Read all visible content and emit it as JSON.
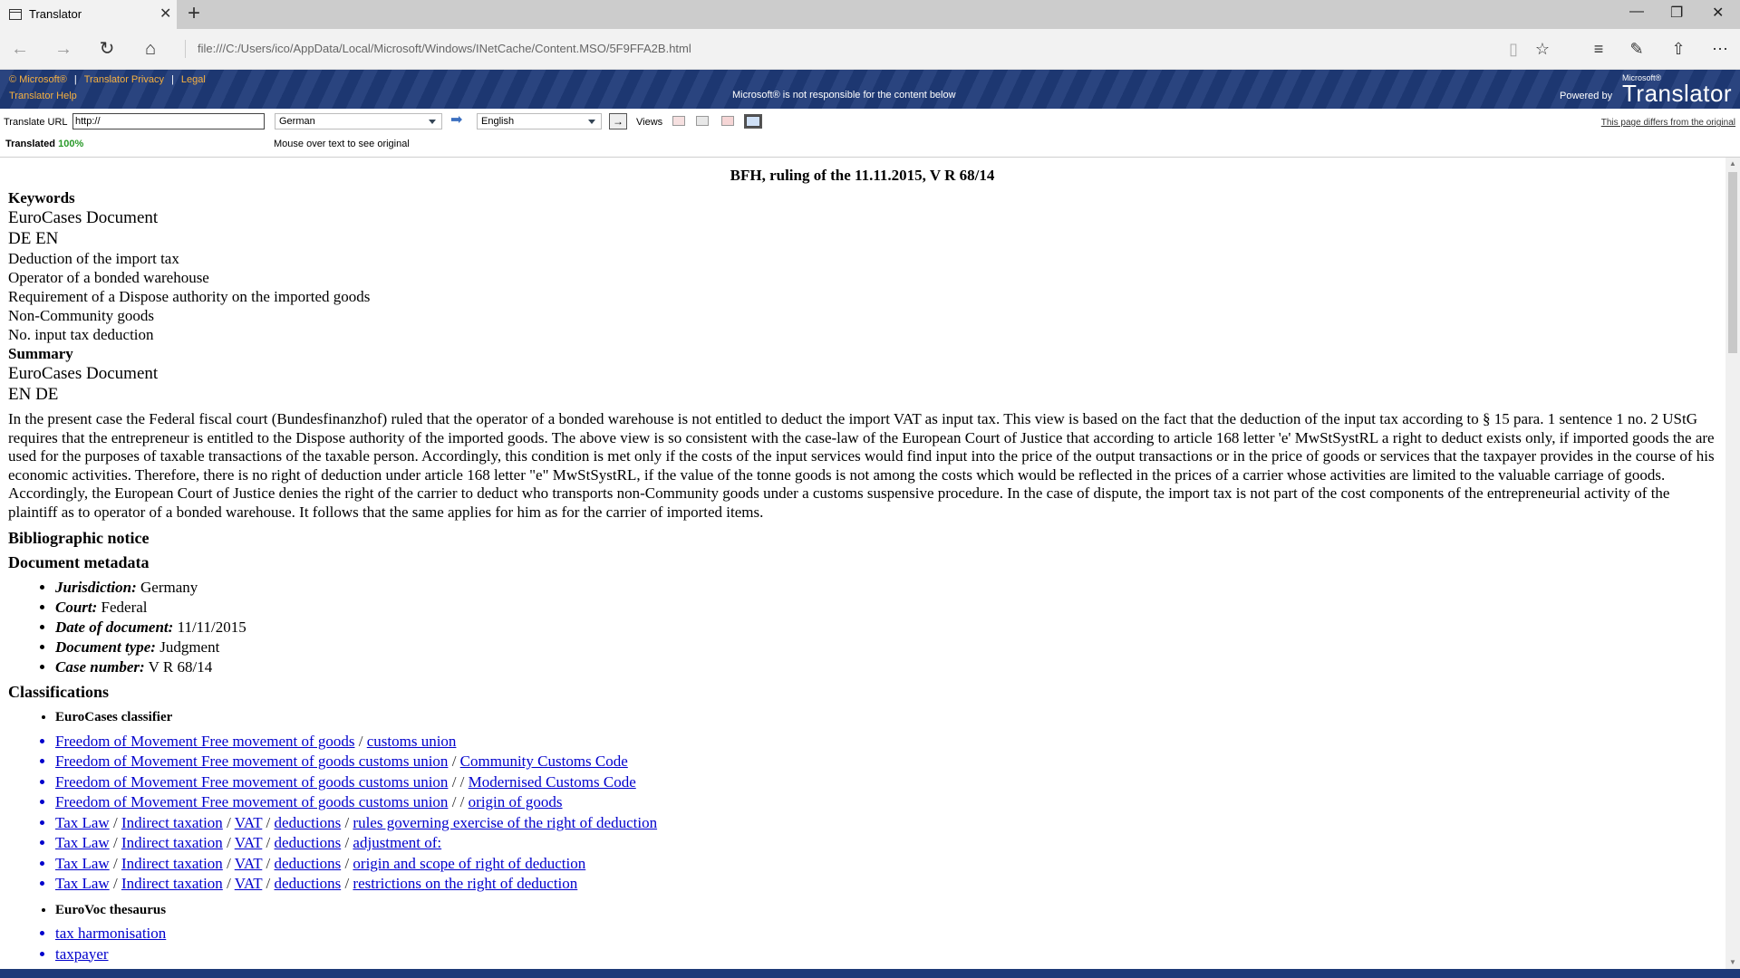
{
  "browser": {
    "tab_title": "Translator",
    "tab_close": "✕",
    "new_tab": "+",
    "url": "file:///C:/Users/ico/AppData/Local/Microsoft/Windows/INetCache/Content.MSO/5F9FFA2B.html",
    "window_controls": {
      "minimize": "—",
      "restore": "❐",
      "close": "✕"
    }
  },
  "banner": {
    "microsoft": "© Microsoft®",
    "privacy": "Translator Privacy",
    "legal": "Legal",
    "help": "Translator Help",
    "notice": "Microsoft® is not responsible for the content below",
    "powered_by": "Powered by",
    "ms_small": "Microsoft®",
    "brand": "Translator"
  },
  "toolbar": {
    "translate_url_label": "Translate URL",
    "url_value": "http://",
    "from_lang": "German",
    "to_lang": "English",
    "views_label": "Views",
    "differs": "This page differs from the original",
    "translated_label": "Translated",
    "translated_pct": "100%",
    "mouse_hint": "Mouse over text to see original"
  },
  "document": {
    "title": "BFH, ruling of the 11.11.2015, V R 68/14",
    "keywords_heading": "Keywords",
    "eurocases_doc_1": "EuroCases Document",
    "langs_1": "DE EN",
    "keywords": [
      "Deduction of the import tax",
      "Operator of a bonded warehouse",
      "Requirement of a Dispose authority on the imported goods",
      "Non-Community goods",
      "No. input tax deduction"
    ],
    "summary_heading": "Summary",
    "eurocases_doc_2": "EuroCases Document",
    "langs_2": "EN DE",
    "summary_text": "In the present case the Federal fiscal court (Bundesfinanzhof) ruled that the operator of a bonded warehouse is not entitled to deduct the import VAT as input tax. This view is based on the fact that the deduction of the input tax according to § 15 para. 1 sentence 1 no. 2 UStG requires that the entrepreneur is entitled to the Dispose authority of the imported goods. The above view is so consistent with the case-law of the European Court of Justice that according to article 168 letter 'e' MwStSystRL a right to deduct exists only, if imported goods the are used for the purposes of taxable transactions of the taxable person. Accordingly, this condition is met only if the costs of the input services would find input into the price of the output transactions or in the price of goods or services that the taxpayer provides in the course of his economic activities. Therefore, there is no right of deduction under article 168 letter \"e\" MwStSystRL, if the value of the tonne goods is not among the costs which would be reflected in the prices of a carrier whose activities are limited to the valuable carriage of goods. Accordingly, the European Court of Justice denies the right of the carrier to deduct who transports non-Community goods under a customs suspensive procedure. In the case of dispute, the import tax is not part of the cost components of the entrepreneurial activity of the plaintiff as to operator of a bonded warehouse. It follows that the same applies for him as for the carrier of imported items.",
    "biblio_heading": "Bibliographic notice",
    "metadata_heading": "Document metadata",
    "metadata": [
      {
        "label": "Jurisdiction:",
        "value": " Germany"
      },
      {
        "label": "Court:",
        "value": " Federal"
      },
      {
        "label": "Date of document:",
        "value": " 11/11/2015"
      },
      {
        "label": "Document type:",
        "value": " Judgment"
      },
      {
        "label": "Case number:",
        "value": " V R 68/14"
      }
    ],
    "classifications_heading": "Classifications",
    "eurocases_classifier": "EuroCases classifier",
    "eurovoc_heading": "EuroVoc thesaurus",
    "class_rows": [
      [
        "Freedom of Movement Free movement of goods",
        "customs union"
      ],
      [
        "Freedom of Movement Free movement of goods customs union",
        "Community Customs Code"
      ],
      [
        "Freedom of Movement Free movement of goods customs union",
        "",
        "Modernised Customs Code"
      ],
      [
        "Freedom of Movement Free movement of goods customs union",
        "",
        "origin of goods"
      ],
      [
        "Tax Law",
        "Indirect taxation",
        "VAT",
        "deductions",
        "rules governing exercise of the right of deduction"
      ],
      [
        "Tax Law",
        "Indirect taxation",
        "VAT",
        "deductions",
        "adjustment of:"
      ],
      [
        "Tax Law",
        "Indirect taxation",
        "VAT",
        "deductions",
        "origin and scope of right of deduction"
      ],
      [
        "Tax Law",
        "Indirect taxation",
        "VAT",
        "deductions",
        "restrictions on the right of deduction"
      ]
    ],
    "eurovoc_items": [
      "tax harmonisation",
      "taxpayer"
    ]
  }
}
